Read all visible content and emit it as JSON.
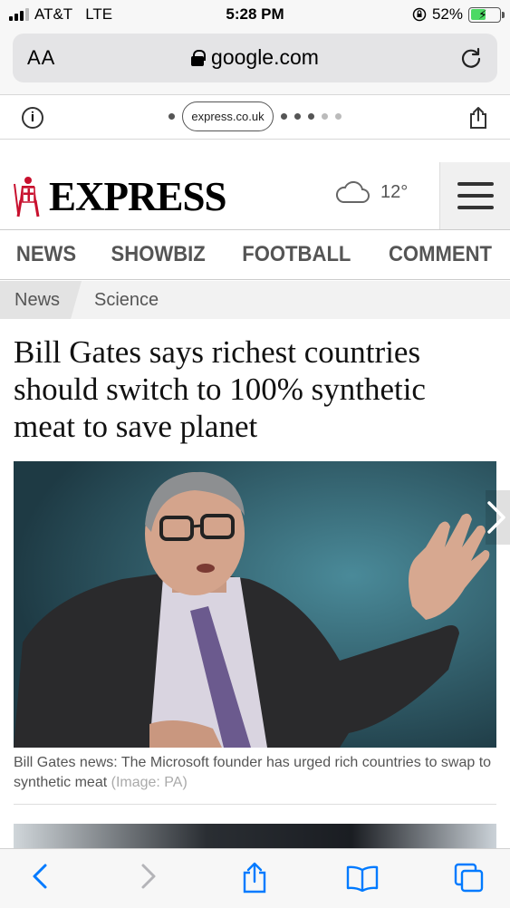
{
  "status_bar": {
    "carrier": "AT&T",
    "network": "LTE",
    "time": "5:28 PM",
    "battery_percent": "52%",
    "battery_level": 0.52
  },
  "browser": {
    "text_size_label": "AA",
    "domain": "google.com",
    "site_pill": "express.co.uk"
  },
  "site": {
    "logo_text": "EXPRESS",
    "temperature": "12°",
    "nav": [
      "NEWS",
      "SHOWBIZ",
      "FOOTBALL",
      "COMMENT"
    ],
    "breadcrumb": [
      "News",
      "Science"
    ]
  },
  "article": {
    "headline": "Bill Gates says richest countries should switch to 100% synthetic meat to save planet",
    "caption": "Bill Gates news: The Microsoft founder has urged rich countries to swap to synthetic meat",
    "credit": "(Image: PA)"
  },
  "colors": {
    "link_blue": "#007aff",
    "battery_green": "#4cd964"
  }
}
